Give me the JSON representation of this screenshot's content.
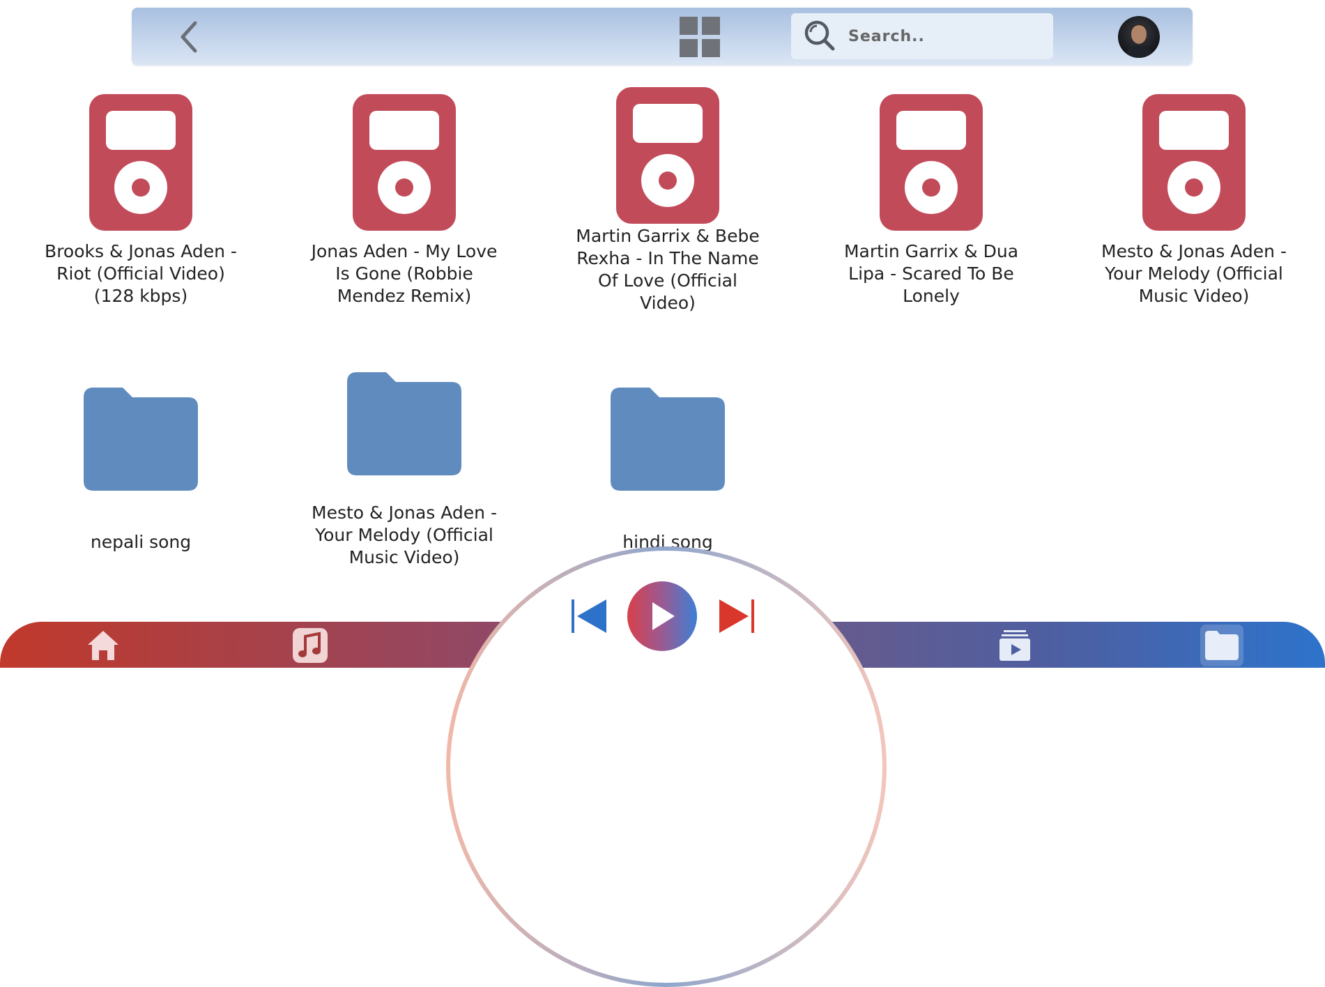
{
  "search": {
    "placeholder": "Search.."
  },
  "files": [
    {
      "title": "Brooks & Jonas Aden - Riot (Official Video) (128 kbps)"
    },
    {
      "title": "Jonas Aden - My Love Is Gone (Robbie Mendez Remix)"
    },
    {
      "title": "Martin Garrix & Bebe Rexha - In The Name Of Love (Official Video)"
    },
    {
      "title": "Martin Garrix & Dua Lipa - Scared To Be Lonely"
    },
    {
      "title": "Mesto & Jonas Aden - Your Melody (Official Music Video)"
    }
  ],
  "folders": [
    {
      "title": "nepali song"
    },
    {
      "title": "Mesto & Jonas Aden - Your Melody (Official Music Video)"
    },
    {
      "title": "hindi song"
    }
  ],
  "colors": {
    "music_icon": "#c24b5a",
    "folder_icon": "#5f8bbf",
    "prev": "#2c72c8",
    "next": "#d9362c"
  },
  "icons": {
    "back": "chevron-left-icon",
    "grid": "grid-view-icon",
    "search": "search-icon",
    "home": "home-icon",
    "music": "music-note-icon",
    "playlist": "playlist-video-icon",
    "folder": "folder-icon"
  }
}
